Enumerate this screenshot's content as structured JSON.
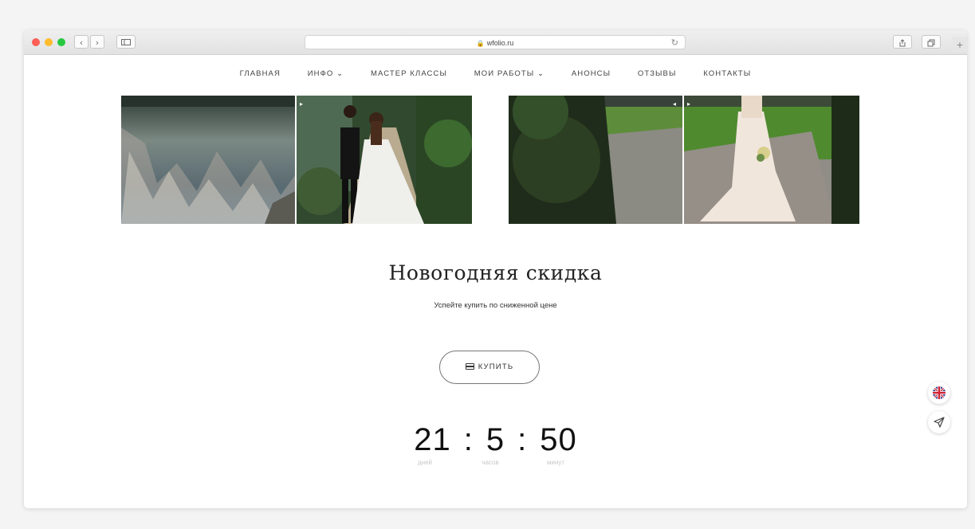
{
  "browser": {
    "url": "wfolio.ru",
    "back_glyph": "‹",
    "forward_glyph": "›",
    "reload_glyph": "↻",
    "new_tab_glyph": "+",
    "traffic_lights": [
      "#fd5f57",
      "#febc2e",
      "#27c840"
    ]
  },
  "nav": {
    "items": [
      {
        "label": "ГЛАВНАЯ"
      },
      {
        "label": "ИНФО ⌄"
      },
      {
        "label": "МАСТЕР КЛАССЫ"
      },
      {
        "label": "МОИ РАБОТЫ ⌄"
      },
      {
        "label": "АНОНСЫ"
      },
      {
        "label": "ОТЗЫВЫ"
      },
      {
        "label": "КОНТАКТЫ"
      }
    ]
  },
  "promo": {
    "title": "Новогодняя скидка",
    "subtitle": "Успейте купить по сниженной цене",
    "buy_label": "КУПИТЬ"
  },
  "countdown": {
    "days": "21",
    "hours": "5",
    "minutes": "50",
    "separator": ":",
    "days_label": "дней",
    "hours_label": "часов",
    "minutes_label": "минут"
  },
  "icons": {
    "language": "uk-flag-icon",
    "telegram": "paper-plane-icon",
    "buy": "credit-card-icon"
  },
  "colors": {
    "accent_dark": "#222222",
    "muted_label": "#c8c8c8"
  }
}
